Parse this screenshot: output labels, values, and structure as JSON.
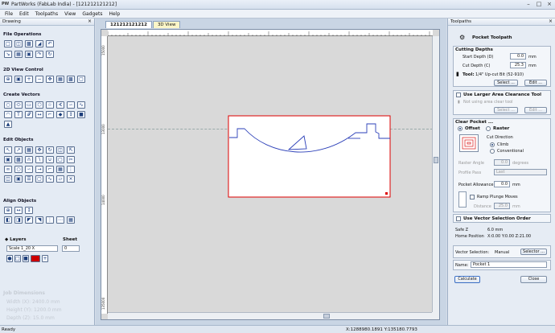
{
  "window": {
    "app_icon": "PW",
    "title": "PartWorks (FabLab India) - [121212121212]"
  },
  "menu": [
    "File",
    "Edit",
    "Toolpaths",
    "View",
    "Gadgets",
    "Help"
  ],
  "left_panel": {
    "header": "Drawing",
    "sections": {
      "file_ops": "File Operations",
      "view_2d": "2D View Control",
      "create_vectors": "Create Vectors",
      "edit_objects": "Edit Objects",
      "align_objects": "Align Objects"
    },
    "layers_label": "Layers",
    "sheet_label": "Sheet",
    "layer_value": "Scale 1_20 X",
    "sheet_value": "0",
    "job_dimensions": {
      "header": "Job Dimensions",
      "width": "Width  (X): 2400.0 mm",
      "height": "Height (Y): 1200.0 mm",
      "depth": "Depth  (Z): 15.0 mm"
    }
  },
  "tabs": [
    "121212121212",
    "3D View"
  ],
  "rulers": {
    "h0": "1000",
    "h1": "10000",
    "v0": "15000",
    "v1": "13000",
    "v2": "14000",
    "v3": "135000"
  },
  "toolpaths": {
    "header": "Toolpaths",
    "title": "Pocket Toolpath",
    "cutting_depths": "Cutting Depths",
    "start_depth_label": "Start Depth (D)",
    "start_depth": "0.0",
    "cut_depth_label": "Cut Depth (C)",
    "cut_depth": "25.3",
    "unit": "mm",
    "tool_label": "Tool:",
    "tool_name": "1/4\" Up-cut Bit (52-910)",
    "select_btn": "Select ...",
    "edit_btn": "Edit ...",
    "larger_area": "Use Larger Area Clearance Tool",
    "not_using": "Not using area clear tool",
    "clear_pocket": "Clear Pocket ...",
    "offset": "Offset",
    "raster": "Raster",
    "cut_direction": "Cut Direction",
    "climb": "Climb",
    "conventional": "Conventional",
    "raster_angle_label": "Raster Angle",
    "raster_angle": "0.0",
    "degrees": "degrees",
    "profile_pass_label": "Profile Pass",
    "profile_pass": "Last",
    "pocket_allowance_label": "Pocket Allowance",
    "pocket_allowance": "0.0",
    "ramp_plunge": "Ramp Plunge Moves",
    "distance_label": "Distance",
    "distance": "25.0",
    "vector_order": "Use Vector Selection Order",
    "safe_z_label": "Safe Z",
    "safe_z": "6.0 mm",
    "home_label": "Home Position",
    "home": "X:0.00 Y:0.00 Z:21.00",
    "vector_selection_label": "Vector Selection:",
    "vector_selection": "Manual",
    "selector_btn": "Selector ...",
    "name_label": "Name:",
    "name_value": "Pocket 1",
    "calculate_btn": "Calculate",
    "close_btn": "Close"
  },
  "status": {
    "left": "Ready",
    "coords": "X:1288980.1891 Y:135180.7793"
  }
}
